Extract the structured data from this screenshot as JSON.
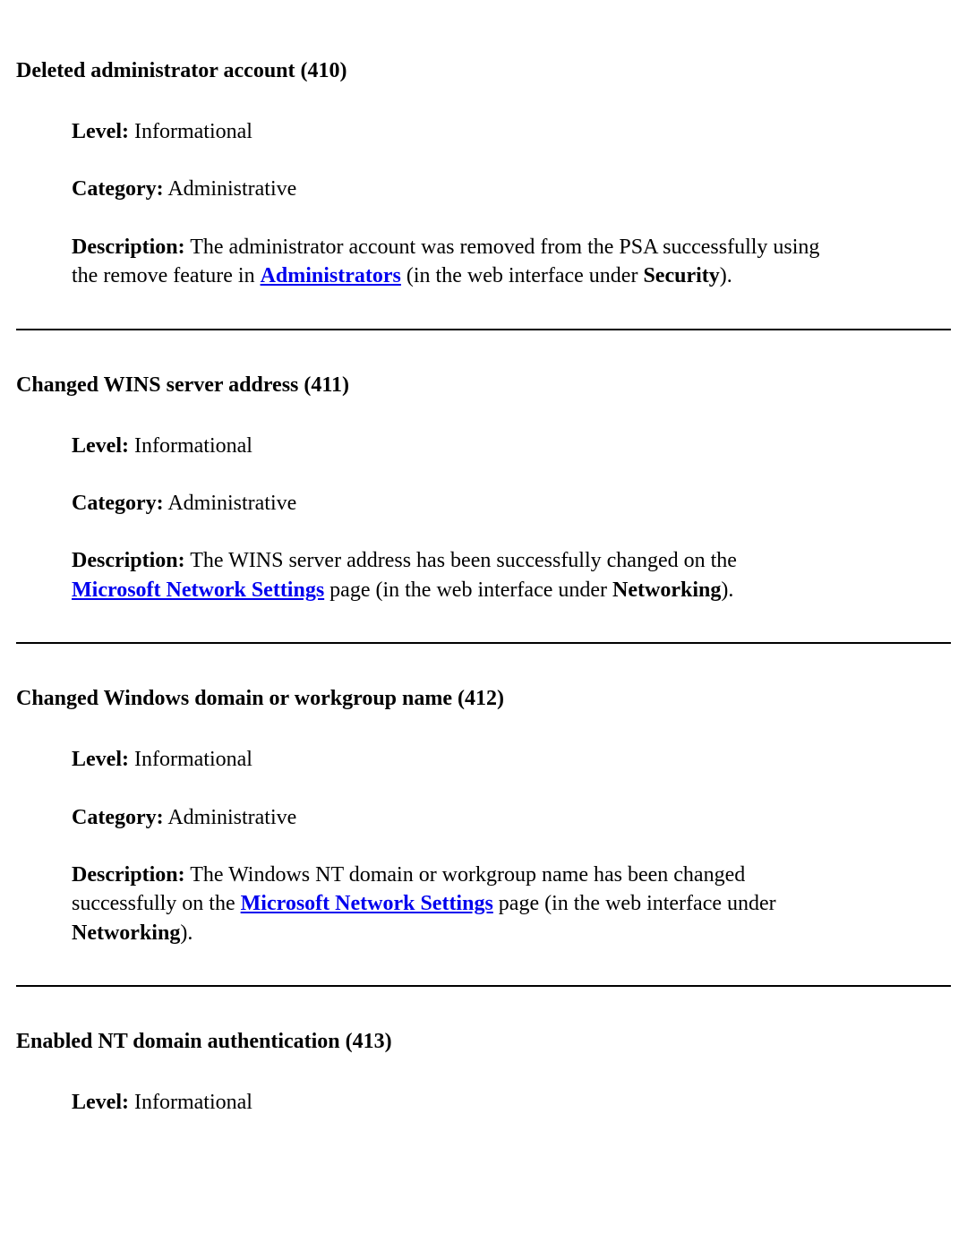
{
  "labels": {
    "level": "Level:",
    "category": "Category:",
    "description": "Description:"
  },
  "entries": [
    {
      "title": "Deleted administrator account (410)",
      "level": "Informational",
      "category": "Administrative",
      "desc": {
        "pre": "The administrator account was removed from the PSA successfully using the remove feature in ",
        "link": "Administrators",
        "mid": " (in the web interface under ",
        "bold": "Security",
        "post": ")."
      }
    },
    {
      "title": "Changed WINS server address (411)",
      "level": "Informational",
      "category": "Administrative",
      "desc": {
        "pre": "The WINS server address has been successfully changed on the ",
        "link": "Microsoft Network Settings",
        "mid": " page (in the web interface under ",
        "bold": "Networking",
        "post": ")."
      }
    },
    {
      "title": "Changed Windows domain or workgroup name (412)",
      "level": "Informational",
      "category": "Administrative",
      "desc": {
        "pre": "The Windows NT domain or workgroup name has been changed successfully on the ",
        "link": "Microsoft Network Settings",
        "mid": " page (in the web interface under ",
        "bold": "Networking",
        "post": ")."
      }
    },
    {
      "title": "Enabled NT domain authentication (413)",
      "level": "Informational",
      "category": "",
      "desc": null
    }
  ]
}
